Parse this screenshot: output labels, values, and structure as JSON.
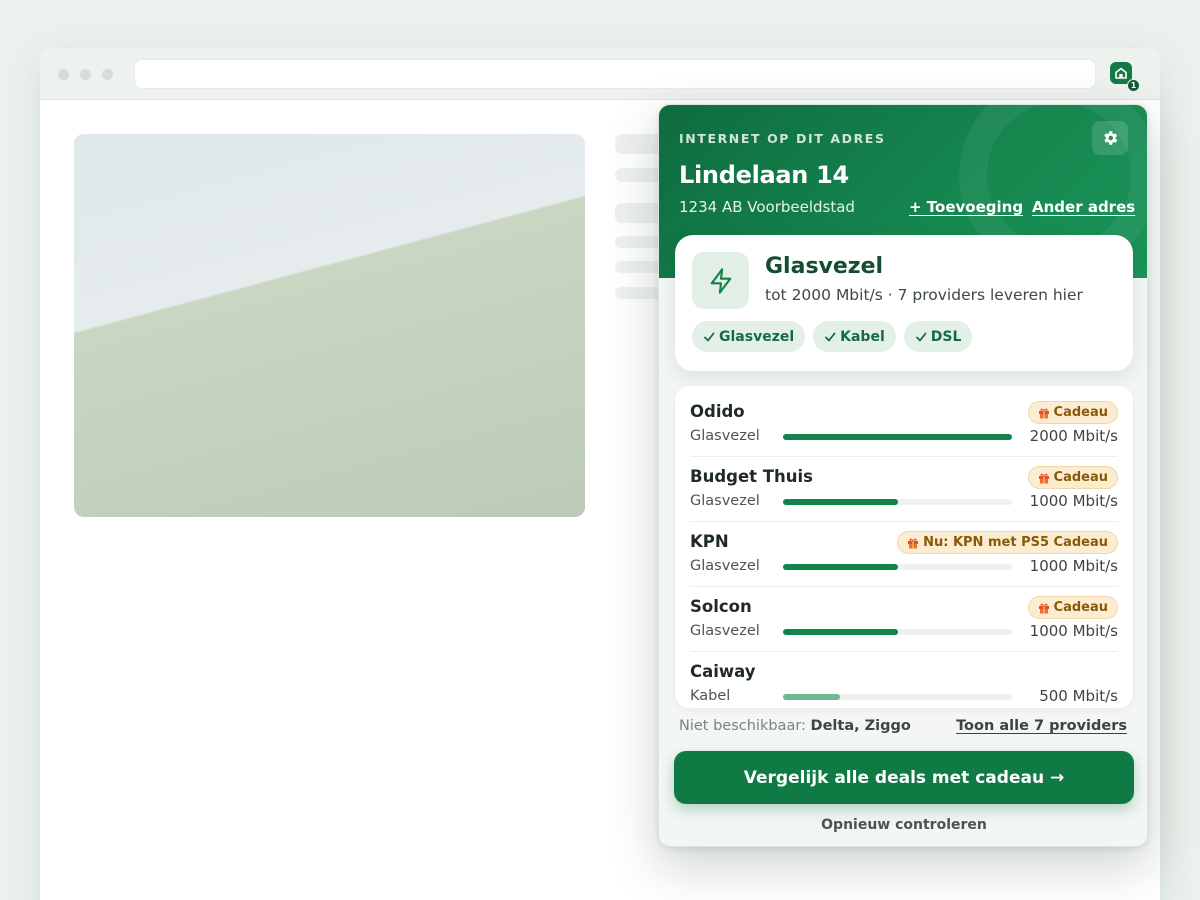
{
  "popup": {
    "eyebrow": "INTERNET OP DIT ADRES",
    "address": {
      "street": "Lindelaan 14",
      "city": "1234 AB Voorbeeldstad"
    },
    "links": {
      "add": "+ Toevoeging",
      "other": "Ander adres"
    },
    "best_tech": {
      "title": "Glasvezel",
      "subtitle": "tot 2000 Mbit/s · 7 providers leveren hier",
      "chips": [
        "Glasvezel",
        "Kabel",
        "DSL"
      ]
    },
    "providers": [
      {
        "name": "Odido",
        "type": "Glasvezel",
        "speed_label": "2000 Mbit/s",
        "speed_mbit": 2000,
        "badge": "Cadeau"
      },
      {
        "name": "Budget Thuis",
        "type": "Glasvezel",
        "speed_label": "1000 Mbit/s",
        "speed_mbit": 1000,
        "badge": "Cadeau"
      },
      {
        "name": "KPN",
        "type": "Glasvezel",
        "speed_label": "1000 Mbit/s",
        "speed_mbit": 1000,
        "badge": "Nu: KPN met PS5 Cadeau"
      },
      {
        "name": "Solcon",
        "type": "Glasvezel",
        "speed_label": "1000 Mbit/s",
        "speed_mbit": 1000,
        "badge": "Cadeau"
      },
      {
        "name": "Caiway",
        "type": "Kabel",
        "speed_label": "500 Mbit/s",
        "speed_mbit": 500,
        "badge": ""
      }
    ],
    "unavailable_label": "Niet beschikbaar:",
    "unavailable_value": "Delta, Ziggo",
    "show_all": "Toon alle 7 providers",
    "cta": "Vergelijk alle deals met cadeau →",
    "recheck": "Opnieuw controleren"
  },
  "extension": {
    "badge_count": "1"
  },
  "icons": {
    "settings": "gear-icon",
    "bolt": "bolt-icon",
    "gift": "gift-icon",
    "check": "check-icon",
    "extension": "house-icon"
  },
  "colors": {
    "brand": "#107a45",
    "brand_dark": "#0f6c3f",
    "badge_bg": "#fbecd2",
    "badge_text": "#8a5a08"
  }
}
